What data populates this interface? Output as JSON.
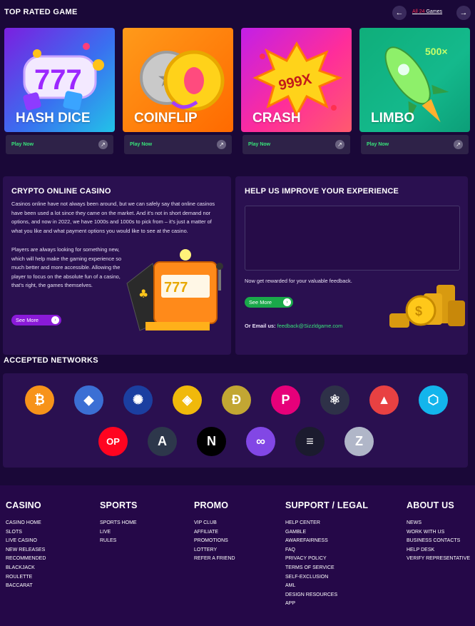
{
  "top_rated": {
    "title": "TOP RATED GAME",
    "nav_all": "All",
    "nav_count": "24",
    "nav_games": "Games"
  },
  "games": [
    {
      "name": "HASH DICE",
      "play": "Play Now"
    },
    {
      "name": "COINFLIP",
      "play": "Play Now"
    },
    {
      "name": "CRASH",
      "play": "Play Now"
    },
    {
      "name": "LIMBO",
      "play": "Play Now"
    }
  ],
  "limbo_multiplier": "500×",
  "crash_multiplier": "999X",
  "casino": {
    "title": "CRYPTO ONLINE CASINO",
    "para1": "Casinos online have not always been around, but we can safely say that online casinos have been used a lot since they came on the market. And it's not in short demand nor options, and now in 2022, we have 1000s and 1000s to pick from – it's just a matter of what you like and what payment options you would like to see at the casino.",
    "para2": "Players are always looking for something new, which will help make the gaming experience so much better and more accessible. Allowing the player to focus on the absolute fun of a casino, that's right, the games themselves.",
    "button": "See More"
  },
  "help": {
    "title": "HELP US IMPROVE YOUR EXPERIENCE",
    "reward": "Now get rewarded for your valuable feedback.",
    "button": "See More",
    "email_label": "Or Email us:",
    "email": "feedback@Sizzldgame.com"
  },
  "networks": {
    "title": "ACCEPTED NETWORKS",
    "coins": [
      {
        "icon": "bitcoin-icon",
        "glyph": "₿",
        "color": "#f7931a"
      },
      {
        "icon": "ethereum-icon",
        "glyph": "◆",
        "color": "#3b6fd4"
      },
      {
        "icon": "cardano-icon",
        "glyph": "✺",
        "color": "#1b3fa0"
      },
      {
        "icon": "binance-icon",
        "glyph": "◈",
        "color": "#f0b90b"
      },
      {
        "icon": "dogecoin-icon",
        "glyph": "Ð",
        "color": "#c2a633"
      },
      {
        "icon": "polkadot-icon",
        "glyph": "P",
        "color": "#e6007a"
      },
      {
        "icon": "cosmos-icon",
        "glyph": "⚛",
        "color": "#2e3148"
      },
      {
        "icon": "avalanche-icon",
        "glyph": "▲",
        "color": "#e84142"
      },
      {
        "icon": "fantom-icon",
        "glyph": "⬡",
        "color": "#13b5ec"
      },
      {
        "icon": "optimism-icon",
        "glyph": "OP",
        "color": "#ff0420"
      },
      {
        "icon": "arbitrum-icon",
        "glyph": "A",
        "color": "#2d374b"
      },
      {
        "icon": "near-icon",
        "glyph": "N",
        "color": "#000000"
      },
      {
        "icon": "polygon-icon",
        "glyph": "∞",
        "color": "#8247e5"
      },
      {
        "icon": "solana-icon",
        "glyph": "≡",
        "color": "#1b1b2e"
      },
      {
        "icon": "zilliqa-icon",
        "glyph": "Z",
        "color": "#b0b6c8"
      }
    ]
  },
  "footer": {
    "casino": {
      "title": "CASINO",
      "items": [
        "CASINO HOME",
        "SLOTS",
        "LIVE CASINO",
        "NEW RELEASES",
        "RECOMMENDED",
        "BLACKJACK",
        "ROULETTE",
        "BACCARAT"
      ]
    },
    "sports": {
      "title": "SPORTS",
      "items": [
        "SPORTS HOME",
        "LIVE",
        "RULES"
      ]
    },
    "promo": {
      "title": "PROMO",
      "items": [
        "VIP CLUB",
        "AFFILIATE",
        "PROMOTIONS",
        "LOTTERY",
        "REFER A FRIEND"
      ]
    },
    "support": {
      "title": "SUPPORT / LEGAL",
      "items": [
        "HELP CENTER",
        "GAMBLE",
        "AWAREFAIRNESS",
        "FAQ",
        "PRIVACY POLICY",
        "TERMS OF SERVICE",
        "SELF-EXCLUSION",
        "AML",
        "DESIGN RESOURCES",
        "APP"
      ]
    },
    "about": {
      "title": "ABOUT US",
      "items": [
        "NEWS",
        "WORK WITH US",
        "BUSINESS CONTACTS",
        "HELP DESK",
        "VERIFY REPRESENTATIVE"
      ]
    }
  }
}
